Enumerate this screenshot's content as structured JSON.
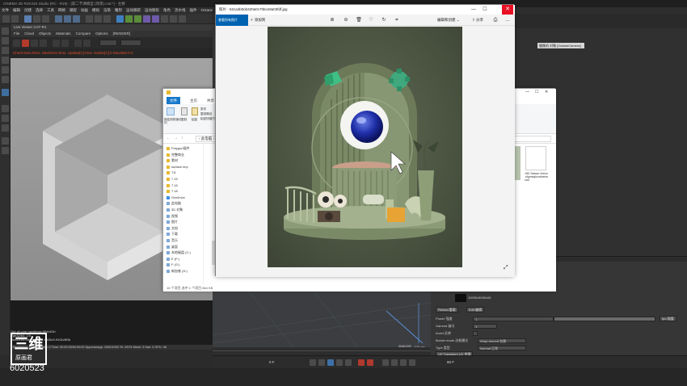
{
  "c4d": {
    "title": "CINEMA 4D R19.024 Studio (RC - R19) - [第二节课模型 (场景).c4d *] - 主要",
    "menus": [
      "文件",
      "编辑",
      "创建",
      "选择",
      "工具",
      "网格",
      "捕捉",
      "动画",
      "模拟",
      "渲染",
      "雕刻",
      "运动跟踪",
      "运动图形",
      "角色",
      "流水线",
      "插件",
      "Octane",
      "脚本",
      "窗口",
      "帮助"
    ],
    "viewer": {
      "title": "Live Viewer 3.07-R1",
      "menu": [
        "File",
        "Cloud",
        "Objects",
        "Materials",
        "Compare",
        "Options"
      ],
      "menu_extra": "[RENDER]",
      "status": "Check:0ms./0ms. MeshGen:0ms. Update[C]:0ms. Nodes[C]:0 Movable:0 0",
      "render_info": [
        "Out-of-core used/max:0Kb/4Gb",
        "Rgb32/64: 1/0",
        "Used/free/total vram: 1.56Gb/4.91Gb/8Gb"
      ],
      "bottom_line": "Rendering: 100%  Ms/sec: 0  Time: 00:00:00/00:00:00  Spp/maxspp: 1000/1000  Tri: 0/57k  Mesh: 3  Hair: 0  GPU: 46"
    },
    "camera_tag": "摄像机 对象 [OctaneCamera]",
    "attributes": {
      "fields": [
        {
          "label": "Power 强度",
          "value": "1."
        },
        {
          "label": "Gamma 伽马",
          "value": "1."
        },
        {
          "label": "Invert 反转",
          "value": ""
        },
        {
          "label": "Border mode 边框模式",
          "value": "Wrap around 包裹"
        },
        {
          "label": "Type 类型",
          "value": "Normal 正常"
        }
      ],
      "buttons": [
        "Reload 重载",
        "Edit 编辑",
        "Ipo 插值",
        "UV Transform UV 变换",
        "Projection 投射"
      ],
      "image_size": "10000x5000x06"
    },
    "viewport_info": "网格间距 : 100 cm",
    "frame_a": "0 F",
    "frame_b": "90 F",
    "id_number": "6020523",
    "logo_text": "三维",
    "logo_sub": "原画君"
  },
  "explorer": {
    "tabs": [
      "文件",
      "主页",
      "共享",
      "查看"
    ],
    "ribbon": [
      "固定到快速访问",
      "复制",
      "粘贴",
      "剪切",
      "复制路径",
      "粘贴快捷方式"
    ],
    "address": "› 此电脑 ›",
    "nav_items": [
      "Polygon插件",
      "完整商业",
      "素材",
      "surface imp",
      "T.8",
      "7.15",
      "7.16",
      "7.18",
      "OneDrive",
      "此电脑",
      "3D 对象",
      "视频",
      "图片",
      "文档",
      "下载",
      "音乐",
      "桌面",
      "本地磁盘 (C:)",
      "E (F:)",
      "F (G:)",
      "新加卷 (H:)"
    ],
    "status": "16 个项目    选中 1 个项目 864 KB",
    "file_label": "180-Taiwan-Vrsion-sfgmslqkcndoeniscad"
  },
  "photos": {
    "title": "照片 - 52ca4b0d4420a0c70bce9a03fdf.jpg",
    "collection_btn": "查看所有照片",
    "add_btn": "添加到",
    "edit_label": "编辑和创建",
    "share_label": "分享",
    "colors": {
      "bg": "#4b5440",
      "accent": "#7e8e6a",
      "close": "#e81123"
    }
  }
}
